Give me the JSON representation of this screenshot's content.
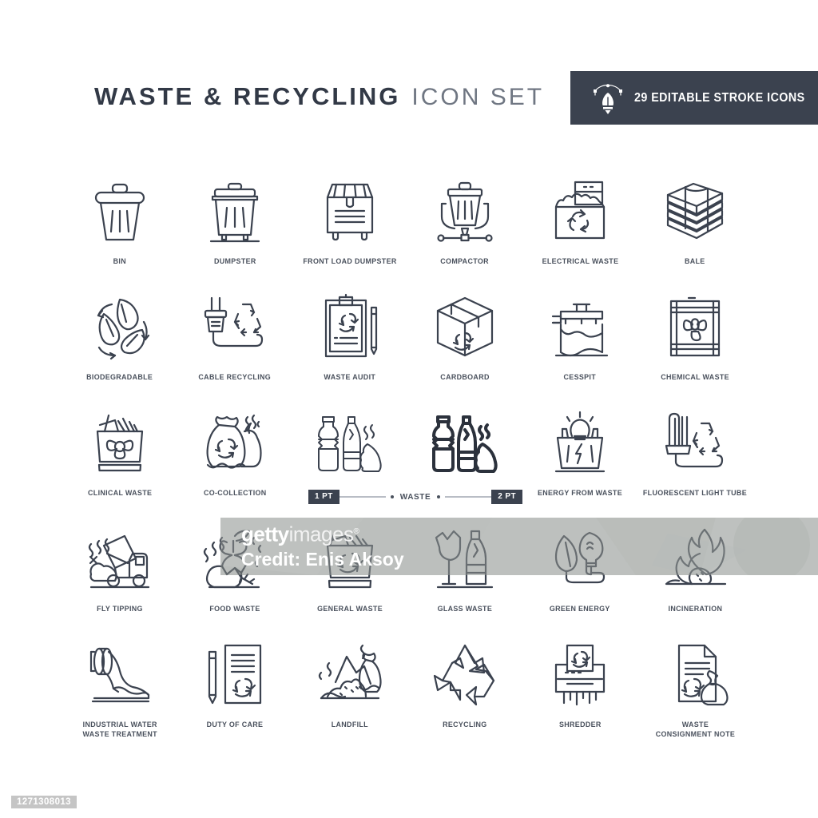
{
  "header": {
    "title_main": "WASTE & RECYCLING",
    "title_sub": "ICON SET",
    "badge_text": "29 EDITABLE STROKE ICONS",
    "badge_icon": "pen-nib-bezier-icon",
    "badge_bg": "#3b424f",
    "title_color": "#323946",
    "subtitle_color": "#6f7682"
  },
  "stroke_bar": {
    "left_chip": "1 PT",
    "middle_label": "WASTE",
    "right_chip": "2 PT"
  },
  "grid": {
    "columns": 6,
    "rows": [
      [
        {
          "label": "BIN",
          "icon": "trash-bin-icon"
        },
        {
          "label": "DUMPSTER",
          "icon": "dumpster-icon"
        },
        {
          "label": "FRONT LOAD DUMPSTER",
          "icon": "front-load-dumpster-icon"
        },
        {
          "label": "COMPACTOR",
          "icon": "compactor-icon"
        },
        {
          "label": "ELECTRICAL WASTE",
          "icon": "electrical-waste-icon"
        },
        {
          "label": "BALE",
          "icon": "bale-icon"
        }
      ],
      [
        {
          "label": "BIODEGRADABLE",
          "icon": "biodegradable-leaves-icon"
        },
        {
          "label": "CABLE RECYCLING",
          "icon": "cable-recycling-icon"
        },
        {
          "label": "WASTE AUDIT",
          "icon": "waste-audit-clipboard-icon"
        },
        {
          "label": "CARDBOARD",
          "icon": "cardboard-box-icon"
        },
        {
          "label": "CESSPIT",
          "icon": "cesspit-icon"
        },
        {
          "label": "CHEMICAL WASTE",
          "icon": "chemical-waste-barrel-icon"
        }
      ],
      [
        {
          "label": "CLINICAL WASTE",
          "icon": "clinical-waste-bin-icon"
        },
        {
          "label": "CO-COLLECTION",
          "icon": "co-collection-bags-icon"
        },
        {
          "label": "",
          "icon": "waste-bottles-1pt-icon"
        },
        {
          "label": "",
          "icon": "waste-bottles-2pt-icon"
        },
        {
          "label": "ENERGY FROM WASTE",
          "icon": "energy-from-waste-icon"
        },
        {
          "label": "FLUORESCENT LIGHT TUBE",
          "icon": "fluorescent-light-tube-icon"
        }
      ],
      [
        {
          "label": "FLY TIPPING",
          "icon": "fly-tipping-truck-icon"
        },
        {
          "label": "FOOD WASTE",
          "icon": "food-waste-apple-icon"
        },
        {
          "label": "GENERAL WASTE",
          "icon": "general-waste-bin-icon"
        },
        {
          "label": "GLASS WASTE",
          "icon": "glass-waste-icon"
        },
        {
          "label": "GREEN ENERGY",
          "icon": "green-energy-bulb-icon"
        },
        {
          "label": "INCINERATION",
          "icon": "incineration-flame-icon"
        }
      ],
      [
        {
          "label": "INDUSTRIAL WATER\nWASTE TREATMENT",
          "icon": "industrial-water-waste-treatment-icon"
        },
        {
          "label": "DUTY OF CARE",
          "icon": "duty-of-care-document-icon"
        },
        {
          "label": "LANDFILL",
          "icon": "landfill-icon"
        },
        {
          "label": "RECYCLING",
          "icon": "recycling-symbol-icon"
        },
        {
          "label": "SHREDDER",
          "icon": "shredder-icon"
        },
        {
          "label": "WASTE\nCONSIGNMENT NOTE",
          "icon": "waste-consignment-note-icon"
        }
      ]
    ]
  },
  "watermark": {
    "brand_bold": "getty",
    "brand_light": "images",
    "registered_mark": "®",
    "credit": "Credit: Enis Aksoy"
  },
  "asset_id": "1271308013"
}
